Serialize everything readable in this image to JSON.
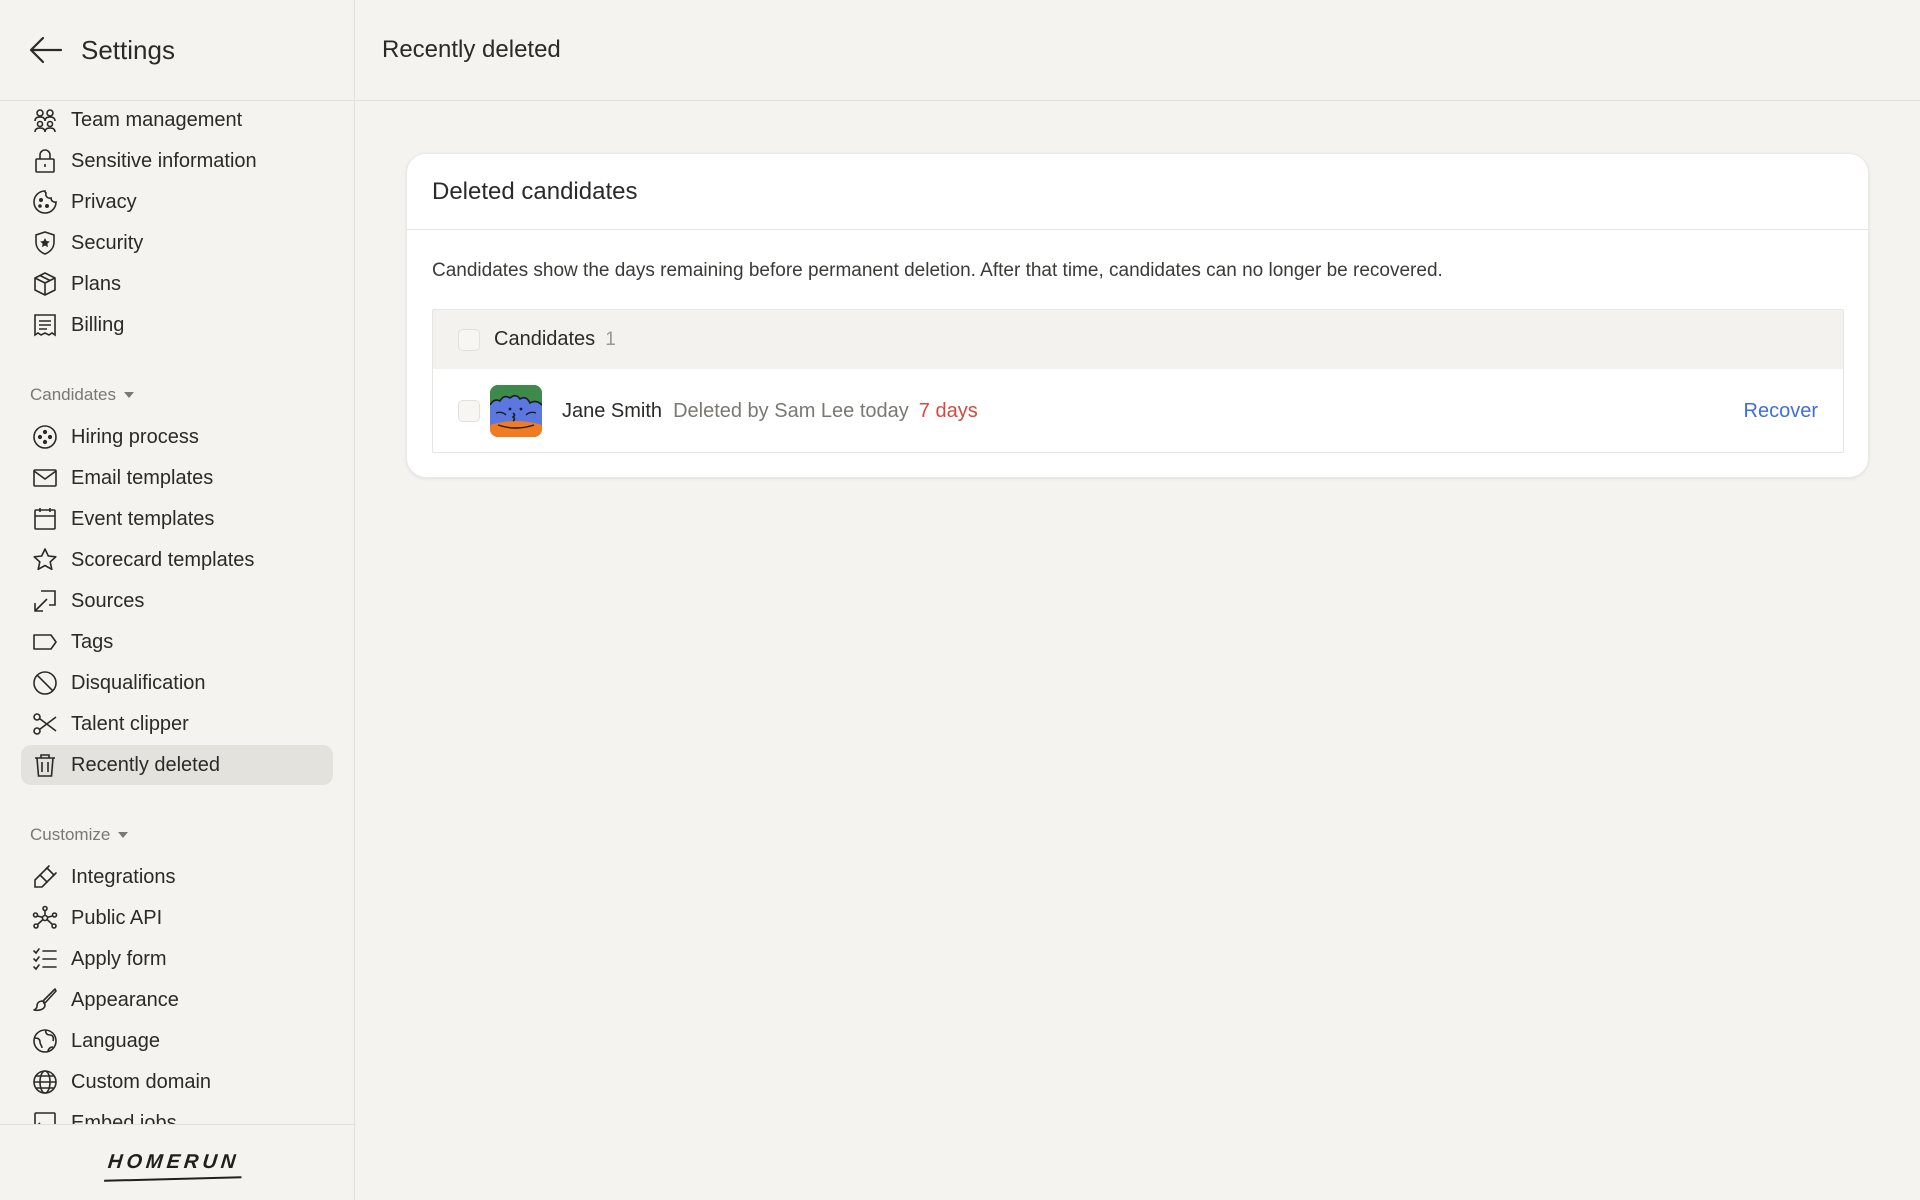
{
  "sidebar": {
    "title": "Settings",
    "items_top": [
      {
        "label": "Team management",
        "icon": "team-icon"
      },
      {
        "label": "Sensitive information",
        "icon": "lock-icon"
      },
      {
        "label": "Privacy",
        "icon": "cookie-icon"
      },
      {
        "label": "Security",
        "icon": "shield-icon"
      },
      {
        "label": "Plans",
        "icon": "box-icon"
      },
      {
        "label": "Billing",
        "icon": "receipt-icon"
      }
    ],
    "section_candidates": "Candidates",
    "items_candidates": [
      {
        "label": "Hiring process",
        "icon": "process-icon"
      },
      {
        "label": "Email templates",
        "icon": "mail-icon"
      },
      {
        "label": "Event templates",
        "icon": "calendar-icon"
      },
      {
        "label": "Scorecard templates",
        "icon": "star-icon"
      },
      {
        "label": "Sources",
        "icon": "source-icon"
      },
      {
        "label": "Tags",
        "icon": "tag-icon"
      },
      {
        "label": "Disqualification",
        "icon": "ban-icon"
      },
      {
        "label": "Talent clipper",
        "icon": "scissors-icon"
      },
      {
        "label": "Recently deleted",
        "icon": "trash-icon",
        "active": true
      }
    ],
    "section_customize": "Customize",
    "items_customize": [
      {
        "label": "Integrations",
        "icon": "plug-icon"
      },
      {
        "label": "Public API",
        "icon": "api-icon"
      },
      {
        "label": "Apply form",
        "icon": "checklist-icon"
      },
      {
        "label": "Appearance",
        "icon": "brush-icon"
      },
      {
        "label": "Language",
        "icon": "language-icon"
      },
      {
        "label": "Custom domain",
        "icon": "globe-icon"
      },
      {
        "label": "Embed jobs",
        "icon": "embed-icon"
      }
    ],
    "logo": "HOMERUN"
  },
  "main": {
    "title": "Recently deleted",
    "card": {
      "title": "Deleted candidates",
      "description": "Candidates show the days remaining before permanent deletion. After that time, candidates can no longer be recovered.",
      "table": {
        "header_label": "Candidates",
        "count": "1",
        "rows": [
          {
            "name": "Jane Smith",
            "deleted_by": "Deleted by Sam Lee today",
            "days_left": "7 days",
            "action": "Recover"
          }
        ]
      }
    }
  },
  "colors": {
    "background": "#f4f3ef",
    "active_item": "#e4e2dc",
    "link": "#3f6fd6",
    "warning": "#d44a3f",
    "avatar_green": "#3d8a4a",
    "avatar_blue": "#5a78e0",
    "avatar_orange": "#f07b22"
  }
}
